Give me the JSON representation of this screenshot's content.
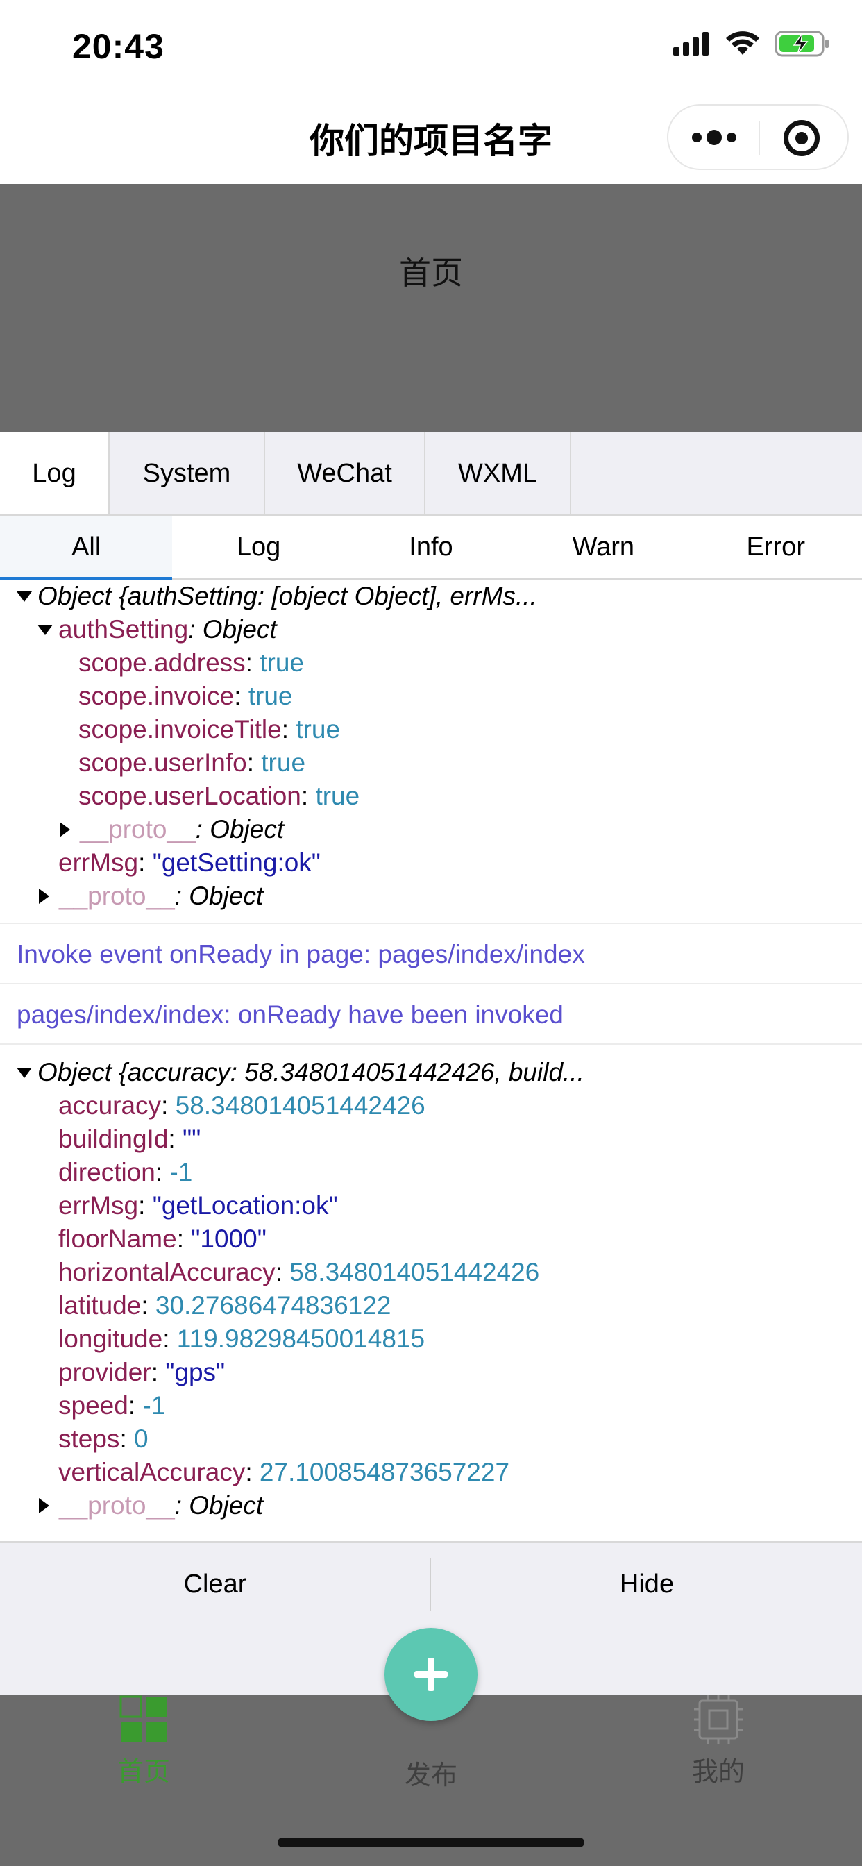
{
  "status_bar": {
    "time": "20:43"
  },
  "nav": {
    "title": "你们的项目名字"
  },
  "page": {
    "text": "首页"
  },
  "console": {
    "tabs": [
      "Log",
      "System",
      "WeChat",
      "WXML"
    ],
    "filters": [
      "All",
      "Log",
      "Info",
      "Warn",
      "Error"
    ],
    "entry1": {
      "summary": "Object {authSetting: [object Object], errMs...",
      "auth_key": "authSetting",
      "auth_type": ": Object",
      "scopes": [
        {
          "key": "scope.address",
          "value": "true"
        },
        {
          "key": "scope.invoice",
          "value": "true"
        },
        {
          "key": "scope.invoiceTitle",
          "value": "true"
        },
        {
          "key": "scope.userInfo",
          "value": "true"
        },
        {
          "key": "scope.userLocation",
          "value": "true"
        }
      ],
      "inner_proto_key": "__proto__",
      "inner_proto_type": ": Object",
      "errmsg_key": "errMsg",
      "errmsg_value": "\"getSetting:ok\"",
      "proto_key": "__proto__",
      "proto_type": ": Object"
    },
    "info1": "Invoke event onReady in page: pages/index/index",
    "info2": "pages/index/index: onReady have been invoked",
    "entry2": {
      "summary": "Object {accuracy: 58.348014051442426, build...",
      "fields": [
        {
          "key": "accuracy",
          "value": "58.348014051442426",
          "kind": "num"
        },
        {
          "key": "buildingId",
          "value": "\"\"",
          "kind": "str"
        },
        {
          "key": "direction",
          "value": "-1",
          "kind": "num"
        },
        {
          "key": "errMsg",
          "value": "\"getLocation:ok\"",
          "kind": "str"
        },
        {
          "key": "floorName",
          "value": "\"1000\"",
          "kind": "str"
        },
        {
          "key": "horizontalAccuracy",
          "value": "58.348014051442426",
          "kind": "num"
        },
        {
          "key": "latitude",
          "value": "30.27686474836122",
          "kind": "num"
        },
        {
          "key": "longitude",
          "value": "119.98298450014815",
          "kind": "num"
        },
        {
          "key": "provider",
          "value": "\"gps\"",
          "kind": "str"
        },
        {
          "key": "speed",
          "value": "-1",
          "kind": "num"
        },
        {
          "key": "steps",
          "value": "0",
          "kind": "num"
        },
        {
          "key": "verticalAccuracy",
          "value": "27.100854873657227",
          "kind": "num"
        }
      ],
      "proto_key": "__proto__",
      "proto_type": ": Object"
    },
    "actions": {
      "clear": "Clear",
      "hide": "Hide"
    }
  },
  "tab_bar": {
    "items": [
      {
        "label": "首页",
        "icon": "grid-icon",
        "active": true
      },
      {
        "label": "发布",
        "icon": "plus-icon",
        "active": false
      },
      {
        "label": "我的",
        "icon": "chip-icon",
        "active": false
      }
    ]
  },
  "colors": {
    "accent": "#1e7ad4",
    "fab": "#5cc8b2",
    "active_tab": "#3a9b2f",
    "log_info": "#5a4fcf",
    "key": "#8a1f52",
    "number": "#2f8ab0",
    "string": "#1a1aa6"
  }
}
